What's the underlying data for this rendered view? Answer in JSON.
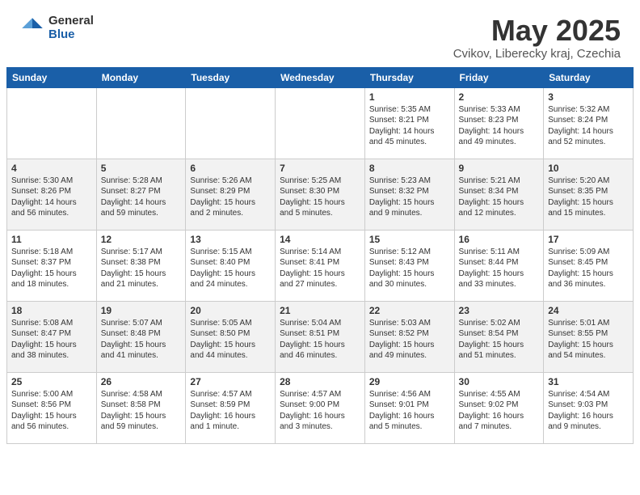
{
  "header": {
    "logo_general": "General",
    "logo_blue": "Blue",
    "month_title": "May 2025",
    "location": "Cvikov, Liberecky kraj, Czechia"
  },
  "days_of_week": [
    "Sunday",
    "Monday",
    "Tuesday",
    "Wednesday",
    "Thursday",
    "Friday",
    "Saturday"
  ],
  "weeks": [
    [
      {
        "day": "",
        "info": ""
      },
      {
        "day": "",
        "info": ""
      },
      {
        "day": "",
        "info": ""
      },
      {
        "day": "",
        "info": ""
      },
      {
        "day": "1",
        "info": "Sunrise: 5:35 AM\nSunset: 8:21 PM\nDaylight: 14 hours\nand 45 minutes."
      },
      {
        "day": "2",
        "info": "Sunrise: 5:33 AM\nSunset: 8:23 PM\nDaylight: 14 hours\nand 49 minutes."
      },
      {
        "day": "3",
        "info": "Sunrise: 5:32 AM\nSunset: 8:24 PM\nDaylight: 14 hours\nand 52 minutes."
      }
    ],
    [
      {
        "day": "4",
        "info": "Sunrise: 5:30 AM\nSunset: 8:26 PM\nDaylight: 14 hours\nand 56 minutes."
      },
      {
        "day": "5",
        "info": "Sunrise: 5:28 AM\nSunset: 8:27 PM\nDaylight: 14 hours\nand 59 minutes."
      },
      {
        "day": "6",
        "info": "Sunrise: 5:26 AM\nSunset: 8:29 PM\nDaylight: 15 hours\nand 2 minutes."
      },
      {
        "day": "7",
        "info": "Sunrise: 5:25 AM\nSunset: 8:30 PM\nDaylight: 15 hours\nand 5 minutes."
      },
      {
        "day": "8",
        "info": "Sunrise: 5:23 AM\nSunset: 8:32 PM\nDaylight: 15 hours\nand 9 minutes."
      },
      {
        "day": "9",
        "info": "Sunrise: 5:21 AM\nSunset: 8:34 PM\nDaylight: 15 hours\nand 12 minutes."
      },
      {
        "day": "10",
        "info": "Sunrise: 5:20 AM\nSunset: 8:35 PM\nDaylight: 15 hours\nand 15 minutes."
      }
    ],
    [
      {
        "day": "11",
        "info": "Sunrise: 5:18 AM\nSunset: 8:37 PM\nDaylight: 15 hours\nand 18 minutes."
      },
      {
        "day": "12",
        "info": "Sunrise: 5:17 AM\nSunset: 8:38 PM\nDaylight: 15 hours\nand 21 minutes."
      },
      {
        "day": "13",
        "info": "Sunrise: 5:15 AM\nSunset: 8:40 PM\nDaylight: 15 hours\nand 24 minutes."
      },
      {
        "day": "14",
        "info": "Sunrise: 5:14 AM\nSunset: 8:41 PM\nDaylight: 15 hours\nand 27 minutes."
      },
      {
        "day": "15",
        "info": "Sunrise: 5:12 AM\nSunset: 8:43 PM\nDaylight: 15 hours\nand 30 minutes."
      },
      {
        "day": "16",
        "info": "Sunrise: 5:11 AM\nSunset: 8:44 PM\nDaylight: 15 hours\nand 33 minutes."
      },
      {
        "day": "17",
        "info": "Sunrise: 5:09 AM\nSunset: 8:45 PM\nDaylight: 15 hours\nand 36 minutes."
      }
    ],
    [
      {
        "day": "18",
        "info": "Sunrise: 5:08 AM\nSunset: 8:47 PM\nDaylight: 15 hours\nand 38 minutes."
      },
      {
        "day": "19",
        "info": "Sunrise: 5:07 AM\nSunset: 8:48 PM\nDaylight: 15 hours\nand 41 minutes."
      },
      {
        "day": "20",
        "info": "Sunrise: 5:05 AM\nSunset: 8:50 PM\nDaylight: 15 hours\nand 44 minutes."
      },
      {
        "day": "21",
        "info": "Sunrise: 5:04 AM\nSunset: 8:51 PM\nDaylight: 15 hours\nand 46 minutes."
      },
      {
        "day": "22",
        "info": "Sunrise: 5:03 AM\nSunset: 8:52 PM\nDaylight: 15 hours\nand 49 minutes."
      },
      {
        "day": "23",
        "info": "Sunrise: 5:02 AM\nSunset: 8:54 PM\nDaylight: 15 hours\nand 51 minutes."
      },
      {
        "day": "24",
        "info": "Sunrise: 5:01 AM\nSunset: 8:55 PM\nDaylight: 15 hours\nand 54 minutes."
      }
    ],
    [
      {
        "day": "25",
        "info": "Sunrise: 5:00 AM\nSunset: 8:56 PM\nDaylight: 15 hours\nand 56 minutes."
      },
      {
        "day": "26",
        "info": "Sunrise: 4:58 AM\nSunset: 8:58 PM\nDaylight: 15 hours\nand 59 minutes."
      },
      {
        "day": "27",
        "info": "Sunrise: 4:57 AM\nSunset: 8:59 PM\nDaylight: 16 hours\nand 1 minute."
      },
      {
        "day": "28",
        "info": "Sunrise: 4:57 AM\nSunset: 9:00 PM\nDaylight: 16 hours\nand 3 minutes."
      },
      {
        "day": "29",
        "info": "Sunrise: 4:56 AM\nSunset: 9:01 PM\nDaylight: 16 hours\nand 5 minutes."
      },
      {
        "day": "30",
        "info": "Sunrise: 4:55 AM\nSunset: 9:02 PM\nDaylight: 16 hours\nand 7 minutes."
      },
      {
        "day": "31",
        "info": "Sunrise: 4:54 AM\nSunset: 9:03 PM\nDaylight: 16 hours\nand 9 minutes."
      }
    ]
  ]
}
